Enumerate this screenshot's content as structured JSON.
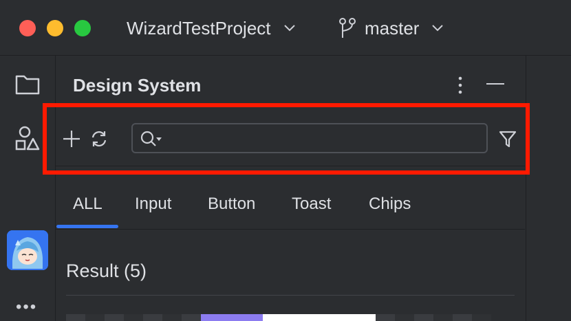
{
  "titlebar": {
    "project_name": "WizardTestProject",
    "branch_name": "master"
  },
  "panel": {
    "title": "Design System"
  },
  "search": {
    "value": "",
    "placeholder": ""
  },
  "tabs": [
    {
      "label": "ALL",
      "selected": true
    },
    {
      "label": "Input",
      "selected": false
    },
    {
      "label": "Button",
      "selected": false
    },
    {
      "label": "Toast",
      "selected": false
    },
    {
      "label": "Chips",
      "selected": false
    }
  ],
  "result": {
    "label": "Result (5)"
  },
  "colors": {
    "accent": "#3574f0",
    "highlight": "#ff1a00",
    "background": "#2b2d30"
  },
  "icons": {
    "sidebar": [
      "folder-icon",
      "shapes-icon",
      "plugin-avatar-icon",
      "more-icon"
    ],
    "toolbar": [
      "add-icon",
      "refresh-icon",
      "search-icon",
      "filter-icon"
    ]
  }
}
